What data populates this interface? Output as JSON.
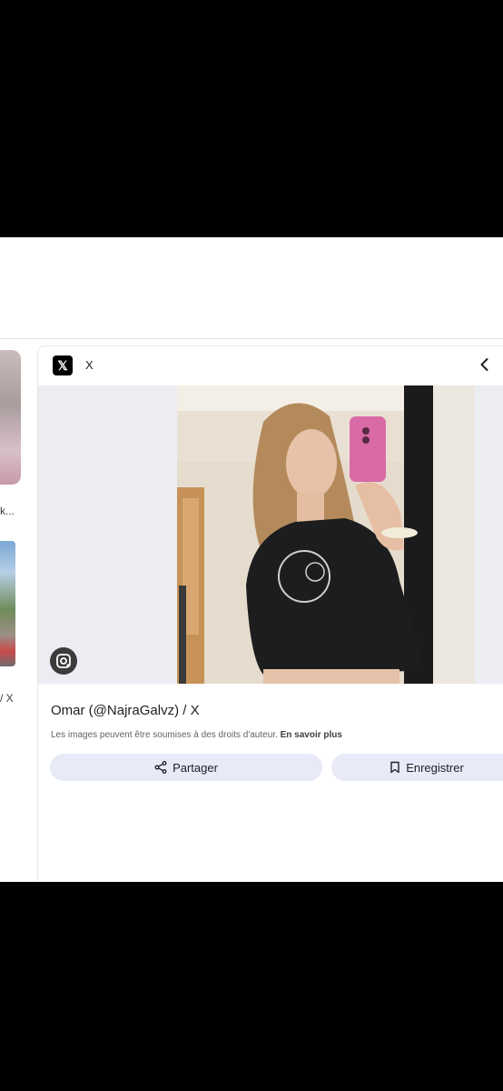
{
  "left_results": {
    "item1_caption": "k...",
    "item2_caption": "/ X"
  },
  "panel": {
    "source_logo": "𝕏",
    "source_name": "X",
    "collapse_icon": "chevron-left-icon",
    "title": "Omar (@NajraGalvz) / X",
    "copyright_text": "Les images peuvent être soumises à des droits d'auteur.",
    "learn_more": "En savoir plus",
    "share_label": "Partager",
    "save_label": "Enregistrer"
  }
}
